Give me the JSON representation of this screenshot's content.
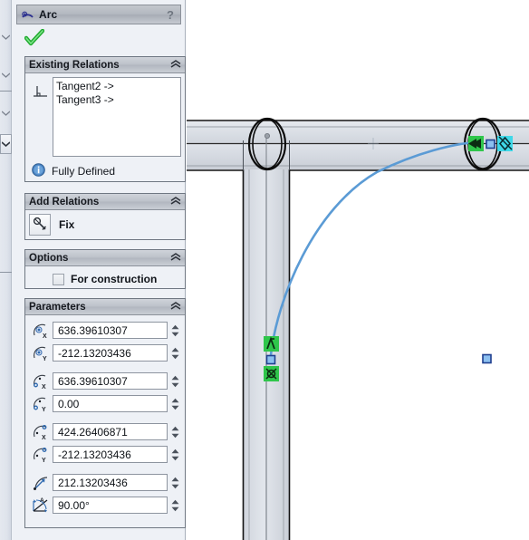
{
  "panel": {
    "title": "Arc",
    "title_icon": "arc-icon",
    "help_label": "?",
    "ok_icon": "green-check-icon"
  },
  "existing_relations": {
    "header": "Existing Relations",
    "collapse_icon": "chevron-up-icon",
    "list_icon": "relation-icon",
    "items": [
      "Tangent2 ->",
      "Tangent3 ->"
    ],
    "status": "Fully Defined",
    "status_icon": "info-icon"
  },
  "add_relations": {
    "header": "Add Relations",
    "collapse_icon": "chevron-up-icon",
    "fix_label": "Fix",
    "fix_icon": "fix-anchor-icon"
  },
  "options": {
    "header": "Options",
    "collapse_icon": "chevron-up-icon",
    "for_construction_label": "For construction",
    "for_construction_checked": false
  },
  "parameters": {
    "header": "Parameters",
    "collapse_icon": "chevron-up-icon",
    "fields": [
      {
        "icon": "arc-center-x-icon",
        "label": "Center X",
        "value": "636.39610307",
        "group": 0
      },
      {
        "icon": "arc-center-y-icon",
        "label": "Center Y",
        "value": "-212.13203436",
        "group": 0
      },
      {
        "icon": "arc-start-x-icon",
        "label": "Start X",
        "value": "636.39610307",
        "group": 1
      },
      {
        "icon": "arc-start-y-icon",
        "label": "Start Y",
        "value": "0.00",
        "group": 1
      },
      {
        "icon": "arc-end-x-icon",
        "label": "End X",
        "value": "424.26406871",
        "group": 2
      },
      {
        "icon": "arc-end-y-icon",
        "label": "End Y",
        "value": "-212.13203436",
        "group": 2
      },
      {
        "icon": "arc-radius-icon",
        "label": "Radius",
        "value": "212.13203436",
        "group": 3
      },
      {
        "icon": "arc-angle-icon",
        "label": "Angle",
        "value": "90.00°",
        "group": 4
      }
    ],
    "spinner_icon": "spinner-up-down-icon"
  },
  "flyout": {
    "icon": "flyout-arrows-icon"
  },
  "canvas": {
    "name": "cad-graphics-area",
    "colors": {
      "arc": "#5b9bd5",
      "point_fill": "#8cc0f0",
      "point_stroke": "#1f3f8f",
      "relation_green": "#2fc64b",
      "relation_cyan": "#3fd8e8",
      "beam_face": "#d2d7de",
      "beam_edge": "#1a1a1a",
      "background": "#ffffff"
    },
    "annotations": [
      {
        "name": "tangent-relation-marker-left",
        "type": "relation-glyph"
      },
      {
        "name": "tangent-relation-marker-right",
        "type": "relation-glyph"
      },
      {
        "name": "arc-endpoint-lower",
        "type": "sketch-point"
      },
      {
        "name": "arc-endpoint-upper",
        "type": "sketch-point"
      },
      {
        "name": "free-sketch-point",
        "type": "sketch-point"
      },
      {
        "name": "origin-crosshair",
        "type": "origin"
      }
    ]
  }
}
